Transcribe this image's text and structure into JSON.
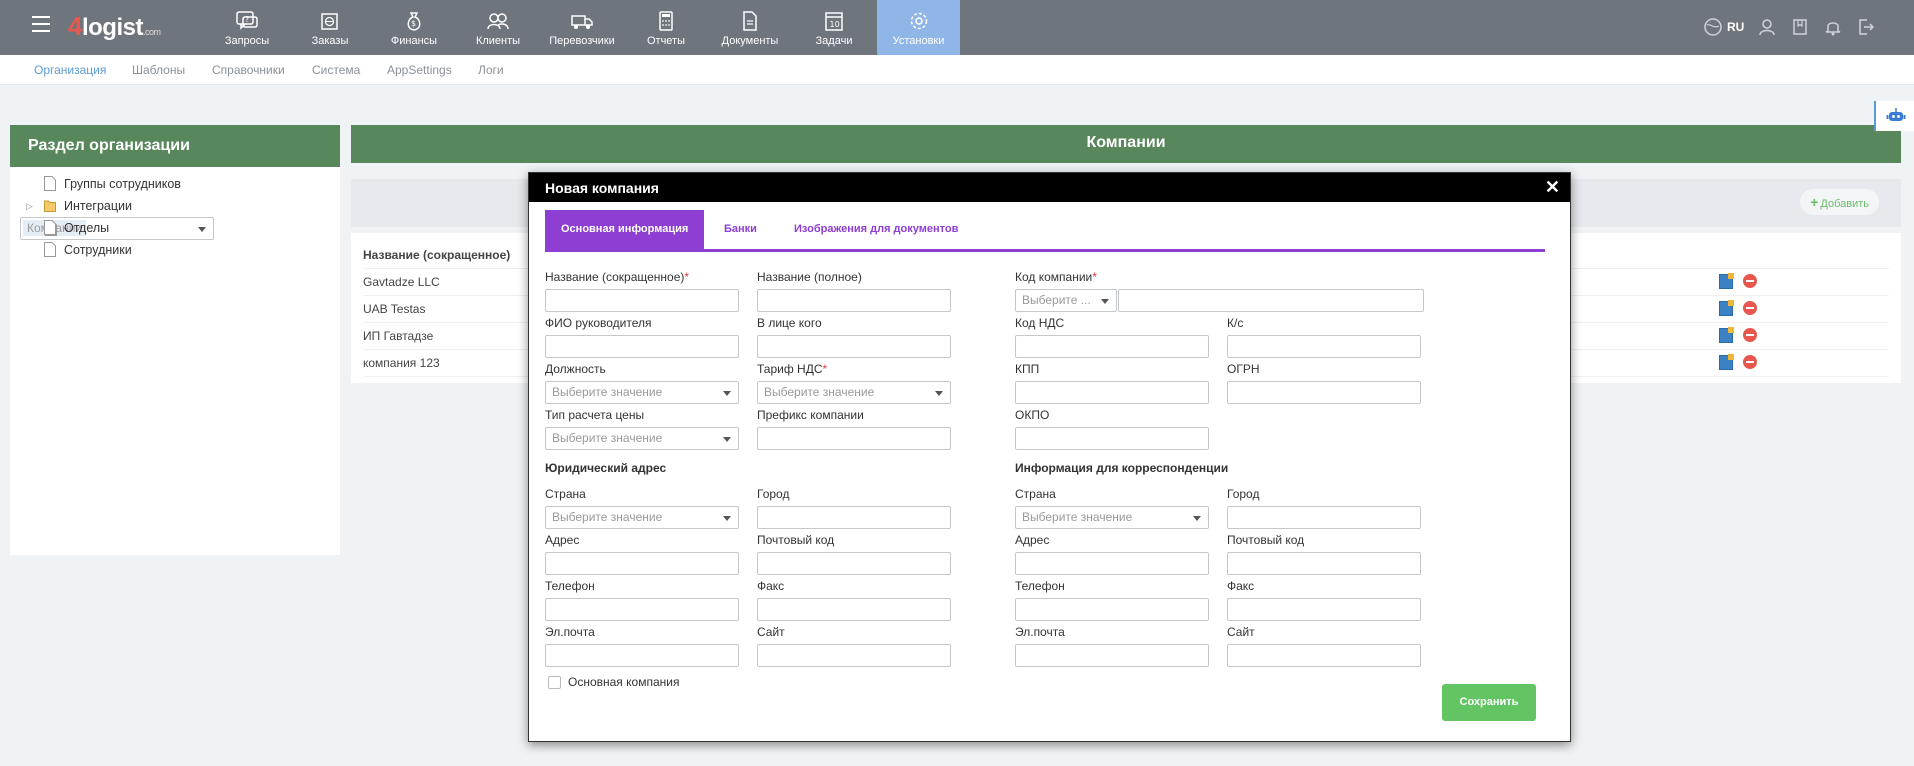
{
  "logo": {
    "four": "4",
    "name": "logist",
    "com": ".com"
  },
  "nav": [
    {
      "label": "Запросы",
      "icon": "chat-question-icon"
    },
    {
      "label": "Заказы",
      "icon": "globe-box-icon"
    },
    {
      "label": "Финансы",
      "icon": "money-bag-icon"
    },
    {
      "label": "Клиенты",
      "icon": "users-icon"
    },
    {
      "label": "Перевозчики",
      "icon": "truck-icon"
    },
    {
      "label": "Отчеты",
      "icon": "calculator-icon"
    },
    {
      "label": "Документы",
      "icon": "document-icon"
    },
    {
      "label": "Задачи",
      "icon": "calendar-icon",
      "day": "10"
    },
    {
      "label": "Установки",
      "icon": "gear-icon",
      "active": true
    }
  ],
  "topright": {
    "lang": "RU"
  },
  "submenu": [
    "Организация",
    "Шаблоны",
    "Справочники",
    "Система",
    "AppSettings",
    "Логи"
  ],
  "left": {
    "title": "Раздел организации",
    "items": [
      "Группы сотрудников",
      "Интеграции",
      "Компании",
      "Отделы",
      "Сотрудники"
    ]
  },
  "main": {
    "title": "Компании",
    "add_label": "Добавить",
    "column": "Название (сокращенное)",
    "rows": [
      "Gavtadze LLC",
      "UAB Testas",
      "ИП Гавтадзе",
      "компания 123"
    ]
  },
  "modal": {
    "title": "Новая компания",
    "close": "✕",
    "tabs": [
      "Основная информация",
      "Банки",
      "Изображения для документов"
    ],
    "fields": {
      "short_name": "Название (сокращенное)",
      "full_name": "Название (полное)",
      "company_code": "Код компании",
      "director": "ФИО руководителя",
      "on_behalf": "В лице кого",
      "vat_code": "Код НДС",
      "ks": "К/с",
      "position": "Должность",
      "vat_rate": "Тариф НДС",
      "kpp": "КПП",
      "ogrn": "ОГРН",
      "price_type": "Тип расчета цены",
      "prefix": "Префикс компании",
      "okpo": "ОКПО"
    },
    "legal_title": "Юридический адрес",
    "corr_title": "Информация для корреспонденции",
    "address": {
      "country": "Страна",
      "city": "Город",
      "addr": "Адрес",
      "zip": "Почтовый код",
      "phone": "Телефон",
      "fax": "Факс",
      "email": "Эл.почта",
      "site": "Сайт"
    },
    "select_placeholder": "Выберите значение",
    "code_placeholder": "Выберите ...",
    "main_company": "Основная компания",
    "save": "Сохранить",
    "required_mark": "*"
  }
}
